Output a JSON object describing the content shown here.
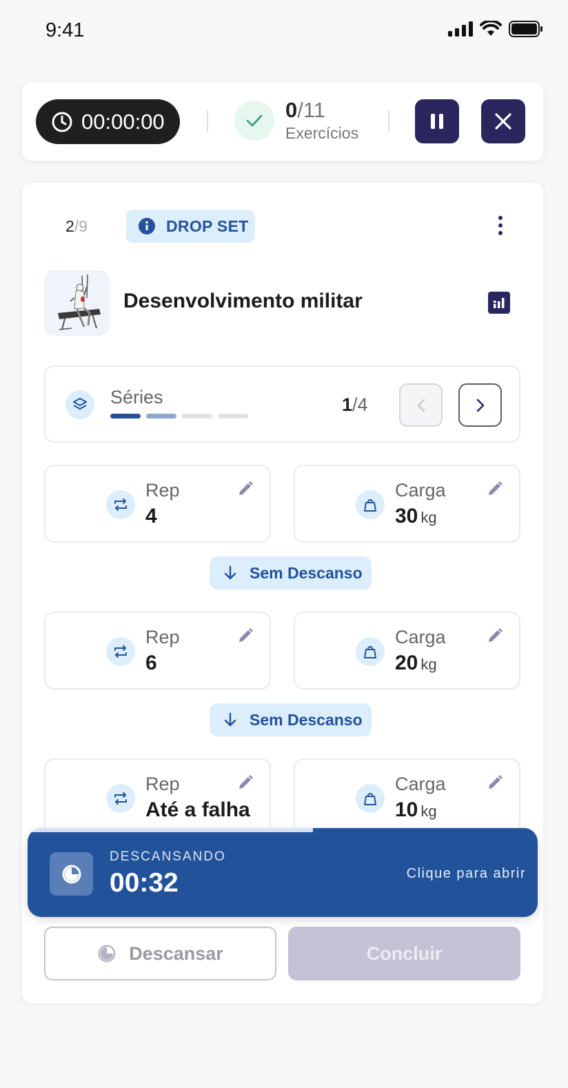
{
  "status_bar": {
    "time": "9:41"
  },
  "session": {
    "timer": "00:00:00",
    "completed": "0",
    "total": "/11",
    "label": "Exercícios"
  },
  "exercise": {
    "index": "2",
    "index_total": "/9",
    "badge": "DROP SET",
    "name": "Desenvolvimento militar"
  },
  "series": {
    "label": "Séries",
    "current": "1",
    "total": "/4",
    "dots": [
      "done",
      "current",
      "pending",
      "pending"
    ]
  },
  "sets": [
    {
      "rep_label": "Rep",
      "rep_value": "4",
      "load_label": "Carga",
      "load_value": "30",
      "load_unit": "kg"
    },
    {
      "rep_label": "Rep",
      "rep_value": "6",
      "load_label": "Carga",
      "load_value": "20",
      "load_unit": "kg"
    },
    {
      "rep_label": "Rep",
      "rep_value": "Até a falha",
      "load_label": "Carga",
      "load_value": "10",
      "load_unit": "kg"
    }
  ],
  "rest_chips": [
    "Sem Descanso",
    "Sem Descanso"
  ],
  "rest_banner": {
    "label": "DESCANSANDO",
    "time": "00:32",
    "action": "Clique para abrir",
    "progress_fraction": 0.56
  },
  "actions": {
    "rest_label": "Descansar",
    "done_label": "Concluir"
  },
  "colors": {
    "primary_dark": "#2a275f",
    "accent_blue": "#21529a",
    "chip_bg": "#dcedfb",
    "success_bg": "#e5f7ef",
    "success": "#2e9e6e"
  }
}
